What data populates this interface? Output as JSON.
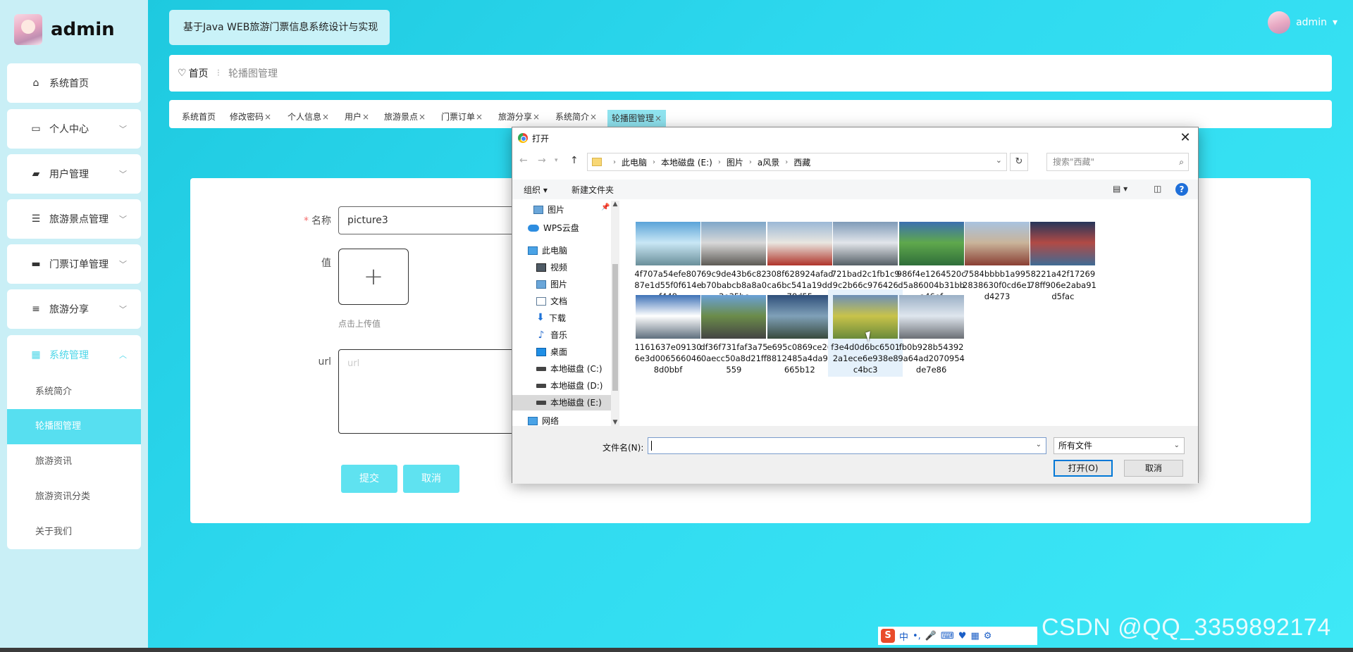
{
  "brand": {
    "title": "admin"
  },
  "system_title": "基于Java WEB旅游门票信息系统设计与实现",
  "user": {
    "name": "admin"
  },
  "sidebar": {
    "items": [
      {
        "label": "系统首页",
        "icon": "home-icon"
      },
      {
        "label": "个人中心",
        "icon": "window-icon"
      },
      {
        "label": "用户管理",
        "icon": "wallet-icon"
      },
      {
        "label": "旅游景点管理",
        "icon": "list-icon"
      },
      {
        "label": "门票订单管理",
        "icon": "chat-icon"
      },
      {
        "label": "旅游分享",
        "icon": "sliders-icon"
      },
      {
        "label": "系统管理",
        "icon": "grid-icon"
      }
    ],
    "submenu": [
      "系统简介",
      "轮播图管理",
      "旅游资讯",
      "旅游资讯分类",
      "关于我们"
    ]
  },
  "breadcrumb": {
    "home": "首页",
    "current": "轮播图管理"
  },
  "tabs": [
    "系统首页",
    "修改密码",
    "个人信息",
    "用户",
    "旅游景点",
    "门票订单",
    "旅游分享",
    "系统简介",
    "轮播图管理"
  ],
  "form": {
    "name_label": "名称",
    "name_value": "picture3",
    "value_label": "值",
    "upload_hint": "点击上传值",
    "url_label": "url",
    "url_placeholder": "url",
    "submit": "提交",
    "cancel": "取消"
  },
  "dialog": {
    "title": "打开",
    "path": [
      "此电脑",
      "本地磁盘 (E:)",
      "图片",
      "a风景",
      "西藏"
    ],
    "search_placeholder": "搜索\"西藏\"",
    "organize": "组织 ▾",
    "new_folder": "新建文件夹",
    "nav_items": [
      {
        "label": "图片",
        "icon": "pictures-icon",
        "level": 2
      },
      {
        "label": "WPS云盘",
        "icon": "cloud-icon",
        "level": 1
      },
      {
        "label": "此电脑",
        "icon": "computer-icon",
        "level": 1
      },
      {
        "label": "视频",
        "icon": "video-icon",
        "level": 2
      },
      {
        "label": "图片",
        "icon": "pictures-icon",
        "level": 2
      },
      {
        "label": "文档",
        "icon": "document-icon",
        "level": 2
      },
      {
        "label": "下载",
        "icon": "download-icon",
        "level": 2
      },
      {
        "label": "音乐",
        "icon": "music-icon",
        "level": 2
      },
      {
        "label": "桌面",
        "icon": "desktop-icon",
        "level": 2
      },
      {
        "label": "本地磁盘 (C:)",
        "icon": "disk-icon",
        "level": 2
      },
      {
        "label": "本地磁盘 (D:)",
        "icon": "disk-icon",
        "level": 2
      },
      {
        "label": "本地磁盘 (E:)",
        "icon": "disk-icon",
        "level": 2
      },
      {
        "label": "网络",
        "icon": "network-icon",
        "level": 1
      }
    ],
    "files": [
      {
        "name": "4f707a54efe80787e1d55f0f614ef448"
      },
      {
        "name": "69c9de43b6c82b70babcb8a8a02e35bc"
      },
      {
        "name": "308f628924afadca6bc541a19dd78d55"
      },
      {
        "name": "721bad2c1fb1c99c2b66c97642662d96"
      },
      {
        "name": "986f4e1264520cd5a86004b31bba46ef"
      },
      {
        "name": "7584bbbb1a9952838630f0cd6e1d4273"
      },
      {
        "name": "8221a42f1726978ff906e2aba91d5fac"
      },
      {
        "name": "1161637e091306e3d0065660468d0bbf"
      },
      {
        "name": "df36f731faf3a750aecc50a8d21ff559"
      },
      {
        "name": "e695c0869ce268812485a4da96665b12"
      },
      {
        "name": "f3e4d0d6bc65012a1ece6e938e8c4bc3"
      },
      {
        "name": "fb0b928b543929a64ad2070954de7e86"
      }
    ],
    "filename_label": "文件名(N):",
    "filename_value": "",
    "filetype": "所有文件",
    "open_button": "打开(O)",
    "cancel_button": "取消"
  },
  "ime": {
    "mode": "中"
  },
  "watermark": "CSDN @QQ_3359892174",
  "colors": {
    "accent": "#57dff0",
    "required": "#f56c6c",
    "dialog_primary": "#0078d7"
  }
}
